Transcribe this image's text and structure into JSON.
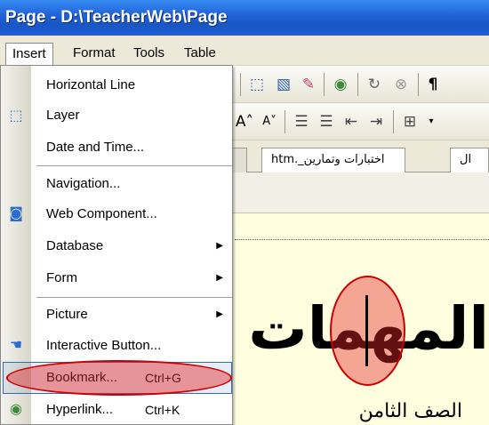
{
  "window": {
    "title": "Page - D:\\TeacherWeb\\Page"
  },
  "menubar": {
    "items": [
      "Insert",
      "Format",
      "Tools",
      "Table"
    ]
  },
  "insert_menu": {
    "items": [
      {
        "label": "Horizontal Line",
        "shortcut": "",
        "submenu": false,
        "icon": ""
      },
      {
        "label": "Layer",
        "shortcut": "",
        "submenu": false,
        "icon": "layer-icon"
      },
      {
        "label": "Date and Time...",
        "shortcut": "",
        "submenu": false,
        "icon": ""
      },
      {
        "label": "Navigation...",
        "shortcut": "",
        "submenu": false,
        "icon": ""
      },
      {
        "label": "Web Component...",
        "shortcut": "",
        "submenu": false,
        "icon": "web-component-icon"
      },
      {
        "label": "Database",
        "shortcut": "",
        "submenu": true,
        "icon": ""
      },
      {
        "label": "Form",
        "shortcut": "",
        "submenu": true,
        "icon": ""
      },
      {
        "label": "Picture",
        "shortcut": "",
        "submenu": true,
        "icon": ""
      },
      {
        "label": "Interactive Button...",
        "shortcut": "",
        "submenu": false,
        "icon": "interactive-button-icon"
      },
      {
        "label": "Bookmark...",
        "shortcut": "Ctrl+G",
        "submenu": false,
        "icon": ""
      },
      {
        "label": "Hyperlink...",
        "shortcut": "Ctrl+K",
        "submenu": false,
        "icon": "hyperlink-icon"
      }
    ],
    "highlighted": "Bookmark..."
  },
  "tabs": [
    "htm._اختبارات وتمارين",
    "ال"
  ],
  "editor": {
    "heading": "المهمات",
    "subheading": "الصف الثامن"
  },
  "colors": {
    "titlebar": "#1f64d8",
    "menubar": "#ece9d8",
    "editor_bg": "#ffffe0",
    "annotation": "#cc0000",
    "highlight": "#316ac5"
  }
}
